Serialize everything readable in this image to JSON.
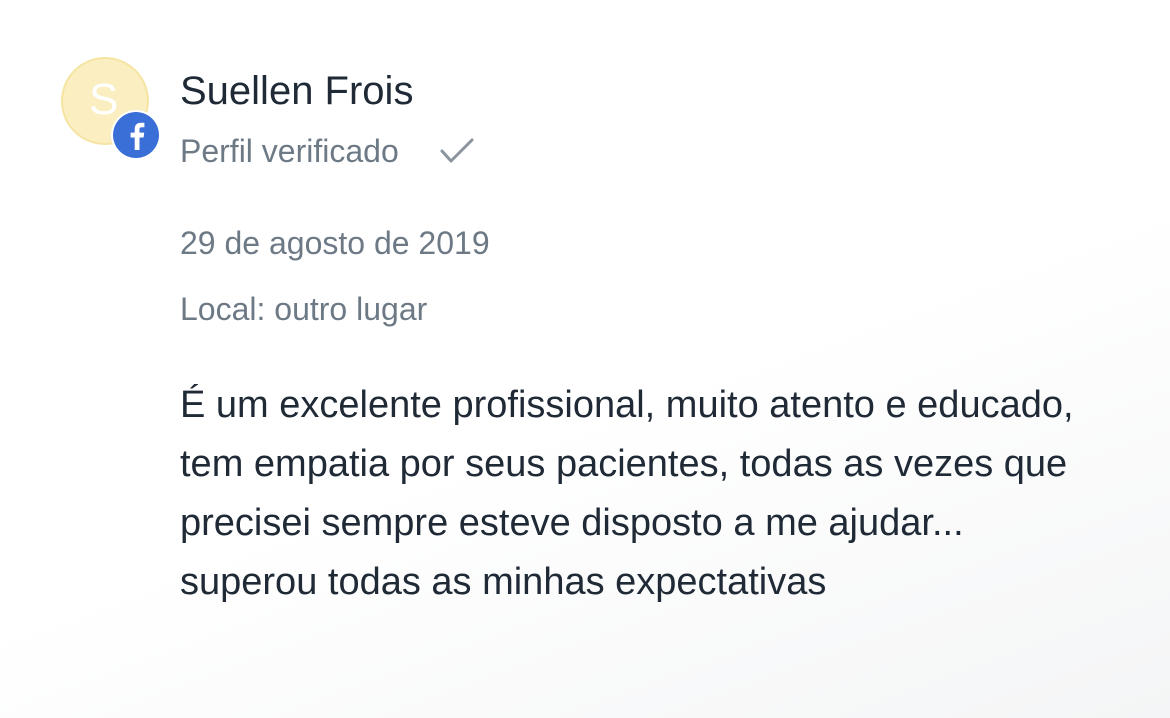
{
  "review": {
    "reviewer": {
      "initial": "S",
      "name": "Suellen Frois",
      "verified_label": "Perfil verificado",
      "source_icon": "facebook-icon",
      "verified_icon": "checkmark-icon"
    },
    "date": "29 de agosto de 2019",
    "location": "Local: outro lugar",
    "text": "É um excelente profissional, muito atento e educado, tem empatia por seus pacientes, todas as vezes que precisei sempre esteve disposto a me ajudar... superou todas as minhas expectativas"
  },
  "colors": {
    "avatar_bg": "#fbeec0",
    "facebook_blue": "#3b6fd8",
    "text_primary": "#1f2a36",
    "text_secondary": "#6d7a86"
  }
}
